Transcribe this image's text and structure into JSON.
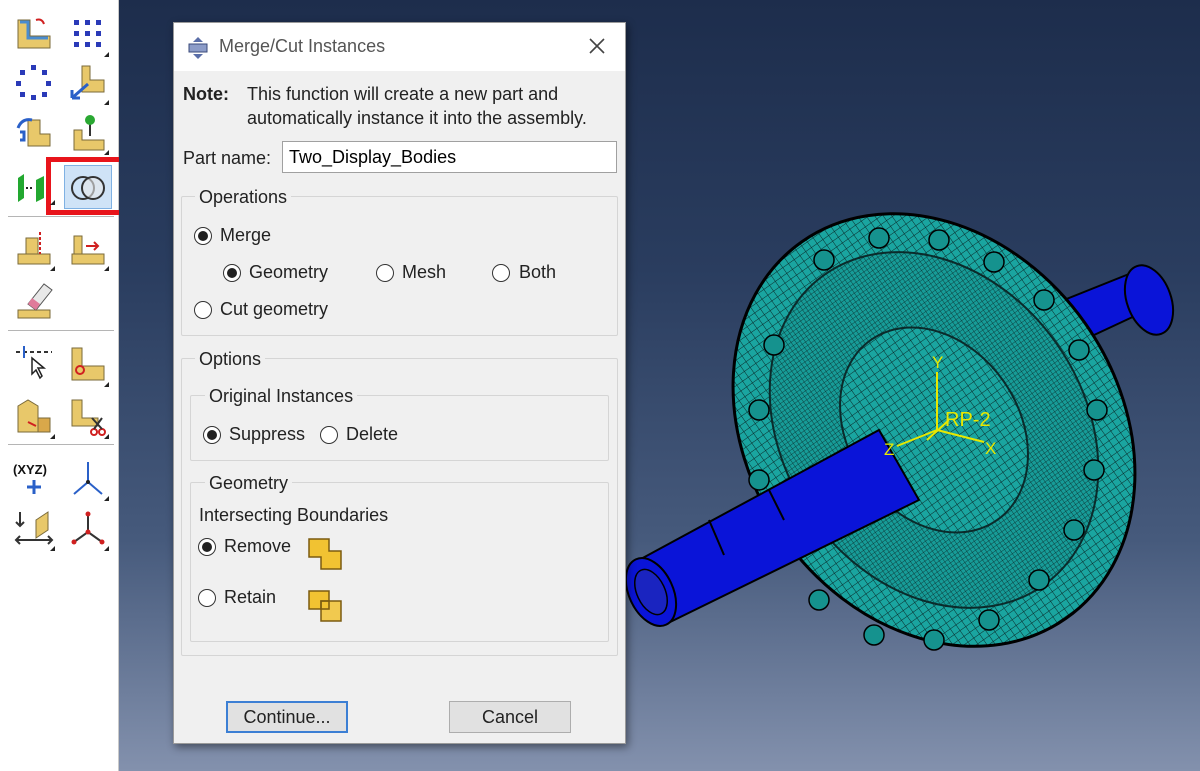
{
  "dialog": {
    "title": "Merge/Cut Instances",
    "note_label": "Note:",
    "note_line1": "This function will create a new part and",
    "note_line2": "automatically instance it into the assembly.",
    "part_name_label": "Part name:",
    "part_name_value": "Two_Display_Bodies",
    "operations": {
      "label": "Operations",
      "merge": "Merge",
      "geometry": "Geometry",
      "mesh": "Mesh",
      "both": "Both",
      "cut_geometry": "Cut geometry",
      "selected_operation": "Merge",
      "selected_merge_type": "Geometry"
    },
    "options": {
      "label": "Options",
      "original_instances": {
        "label": "Original Instances",
        "suppress": "Suppress",
        "delete": "Delete",
        "selected": "Suppress"
      },
      "geometry": {
        "label": "Geometry",
        "intersecting_boundaries": "Intersecting Boundaries",
        "remove": "Remove",
        "retain": "Retain",
        "selected": "Remove"
      }
    },
    "buttons": {
      "continue": "Continue...",
      "cancel": "Cancel"
    }
  },
  "viewport": {
    "triad_labels": {
      "y": "Y",
      "z": "Z",
      "x": "X",
      "ref_point": "RP-2"
    },
    "colors": {
      "mesh": "#1aa5a0",
      "shaft": "#0a14d8",
      "triad": "#e8e800"
    }
  },
  "toolbox": {
    "highlighted_tool": "merge-cut-instances-tool",
    "tools": [
      "instance-part-tool",
      "linear-pattern-tool",
      "radial-pattern-tool",
      "translate-instance-tool",
      "rotate-instance-tool",
      "translate-to-tool",
      "create-display-body-tool",
      "merge-cut-instances-tool",
      "parallel-face-tool",
      "face-to-face-tool",
      "edge-to-edge-tool",
      "coaxial-tool",
      "contact-tool",
      "coincident-point-tool",
      "parallel-csys-tool",
      "datum-point-tool",
      "datum-axis-tool",
      "datum-plane-tool",
      "datum-csys-tool"
    ],
    "xyz_label": "(XYZ)"
  }
}
